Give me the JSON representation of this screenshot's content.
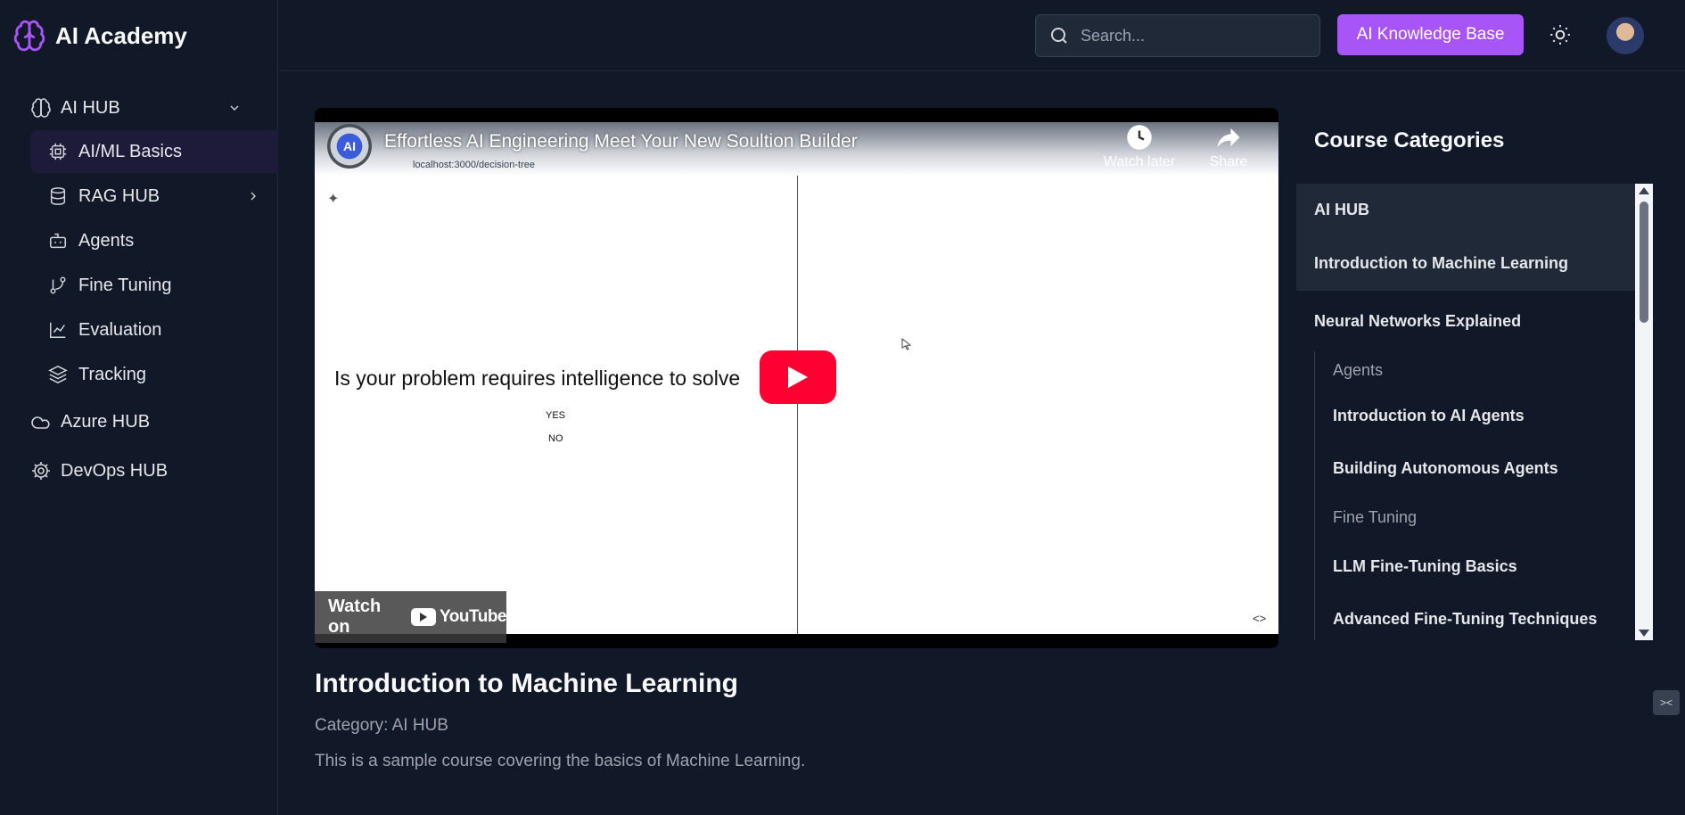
{
  "brand": {
    "name": "AI Academy",
    "accent": "#a855f7"
  },
  "sidebar": {
    "sections": [
      {
        "label": "AI HUB",
        "icon": "brain-icon",
        "expanded": true,
        "items": [
          {
            "label": "AI/ML Basics",
            "icon": "chip-icon",
            "active": true
          },
          {
            "label": "RAG HUB",
            "icon": "database-icon",
            "has_children": true
          },
          {
            "label": "Agents",
            "icon": "bot-icon"
          },
          {
            "label": "Fine Tuning",
            "icon": "branch-icon"
          },
          {
            "label": "Evaluation",
            "icon": "chart-line-icon"
          },
          {
            "label": "Tracking",
            "icon": "layers-icon"
          }
        ]
      },
      {
        "label": "Azure HUB",
        "icon": "cloud-icon"
      },
      {
        "label": "DevOps HUB",
        "icon": "gear-icon"
      }
    ]
  },
  "header": {
    "search_placeholder": "Search...",
    "knowledge_button": "AI Knowledge Base"
  },
  "video": {
    "title": "Effortless AI Engineering Meet Your New Soultion Builder",
    "channel_logo_text": "AI",
    "url": "localhost:3000/decision-tree",
    "watch_later": "Watch later",
    "share": "Share",
    "question": "Is your problem requires intelligence to solve",
    "option_yes": "YES",
    "option_no": "NO",
    "watch_on": "Watch on",
    "youtube": "YouTube"
  },
  "course": {
    "title": "Introduction to Machine Learning",
    "category": "Category: AI HUB",
    "description": "This is a sample course covering the basics of Machine Learning."
  },
  "categories": {
    "heading": "Course Categories",
    "group": "AI HUB",
    "selected": "Introduction to Machine Learning",
    "neural": "Neural Networks Explained",
    "agents_head": "Agents",
    "agents_items": [
      "Introduction to AI Agents",
      "Building Autonomous Agents"
    ],
    "ft_head": "Fine Tuning",
    "ft_items": [
      "LLM Fine-Tuning Basics",
      "Advanced Fine-Tuning Techniques"
    ]
  }
}
